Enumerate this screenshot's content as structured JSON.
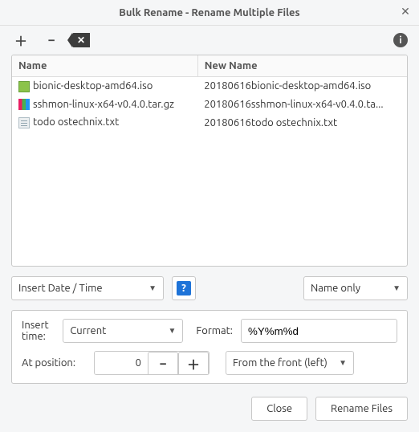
{
  "window": {
    "title": "Bulk Rename - Rename Multiple Files"
  },
  "columns": {
    "name": "Name",
    "new_name": "New Name"
  },
  "files": [
    {
      "icon": "iso",
      "name": "bionic-desktop-amd64.iso",
      "new": "20180616bionic-desktop-amd64.iso"
    },
    {
      "icon": "tar",
      "name": "sshmon-linux-x64-v0.4.0.tar.gz",
      "new": "20180616sshmon-linux-x64-v0.4.0.ta..."
    },
    {
      "icon": "txt",
      "name": "todo ostechnix.txt",
      "new": "20180616todo ostechnix.txt"
    }
  ],
  "mode": {
    "operation": "Insert Date / Time",
    "scope": "Name only"
  },
  "options": {
    "insert_time_label": "Insert time:",
    "insert_time_value": "Current",
    "format_label": "Format:",
    "format_value": "%Y%m%d",
    "position_label": "At position:",
    "position_value": "0",
    "from_value": "From the front (left)"
  },
  "footer": {
    "close": "Close",
    "rename": "Rename Files"
  }
}
